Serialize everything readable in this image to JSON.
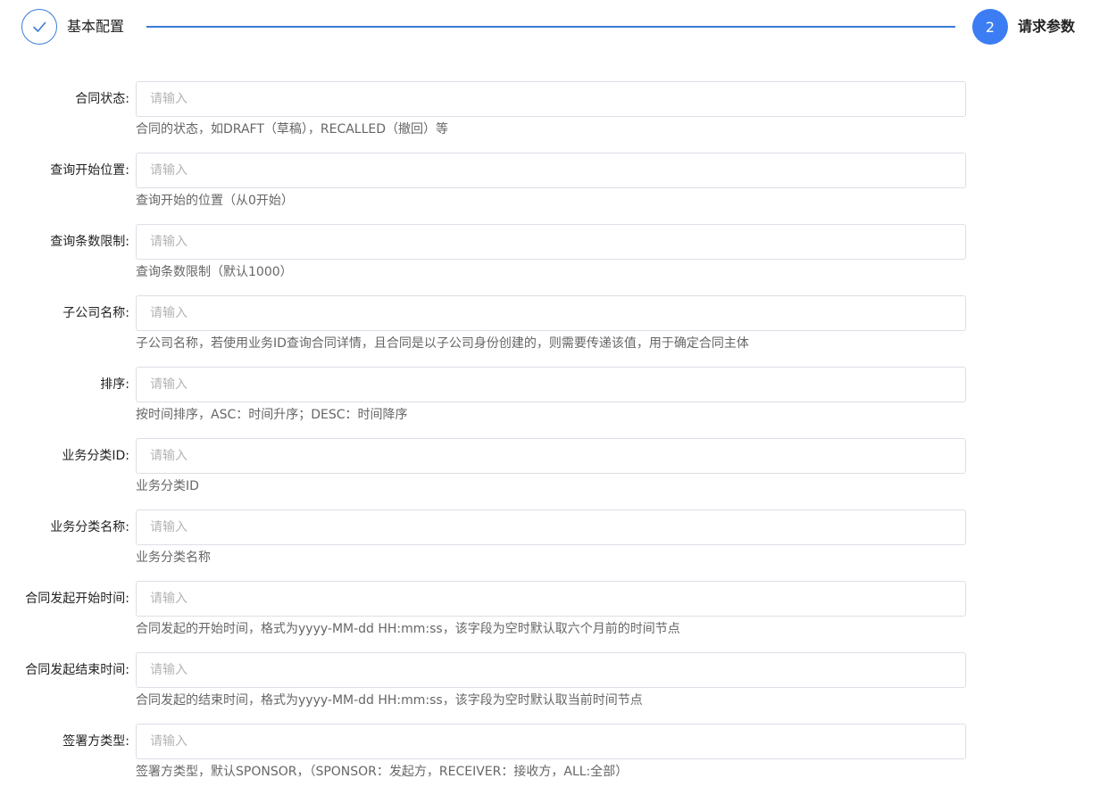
{
  "steps": [
    {
      "label": "基本配置",
      "state": "done",
      "icon": "check-icon"
    },
    {
      "number": "2",
      "label": "请求参数",
      "state": "active"
    }
  ],
  "colors": {
    "accent": "#3c7df4",
    "line": "#3a7bd5"
  },
  "fields": [
    {
      "label": "合同状态:",
      "placeholder": "请输入",
      "help": "合同的状态，如DRAFT（草稿），RECALLED（撤回）等"
    },
    {
      "label": "查询开始位置:",
      "placeholder": "请输入",
      "help": "查询开始的位置（从0开始）"
    },
    {
      "label": "查询条数限制:",
      "placeholder": "请输入",
      "help": "查询条数限制（默认1000）"
    },
    {
      "label": "子公司名称:",
      "placeholder": "请输入",
      "help": "子公司名称，若使用业务ID查询合同详情，且合同是以子公司身份创建的，则需要传递该值，用于确定合同主体"
    },
    {
      "label": "排序:",
      "placeholder": "请输入",
      "help": "按时间排序，ASC：时间升序；DESC：时间降序"
    },
    {
      "label": "业务分类ID:",
      "placeholder": "请输入",
      "help": "业务分类ID"
    },
    {
      "label": "业务分类名称:",
      "placeholder": "请输入",
      "help": "业务分类名称"
    },
    {
      "label": "合同发起开始时间:",
      "placeholder": "请输入",
      "help": "合同发起的开始时间，格式为yyyy-MM-dd HH:mm:ss，该字段为空时默认取六个月前的时间节点"
    },
    {
      "label": "合同发起结束时间:",
      "placeholder": "请输入",
      "help": "合同发起的结束时间，格式为yyyy-MM-dd HH:mm:ss，该字段为空时默认取当前时间节点"
    },
    {
      "label": "签署方类型:",
      "placeholder": "请输入",
      "help": "签署方类型，默认SPONSOR，（SPONSOR：发起方，RECEIVER：接收方，ALL:全部）"
    }
  ]
}
